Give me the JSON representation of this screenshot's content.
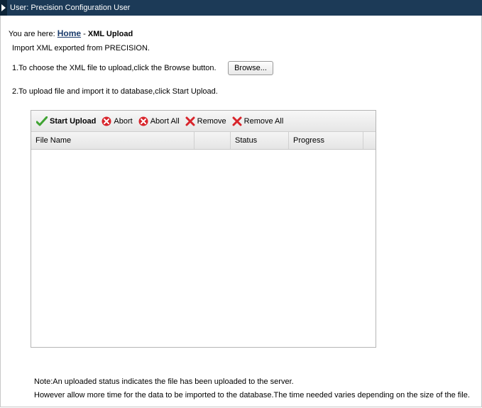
{
  "header": {
    "title": "User: Precision Configuration User"
  },
  "breadcrumb": {
    "prefix": "You are here:",
    "home": "Home",
    "separator": "-",
    "current": "XML Upload"
  },
  "instructions": {
    "intro": "Import XML exported from PRECISION.",
    "step1": "1.To choose the XML file to upload,click the Browse button.",
    "browse_label": "Browse...",
    "step2": "2.To upload file and import it to database,click Start Upload."
  },
  "toolbar": {
    "start_upload": "Start Upload",
    "abort": "Abort",
    "abort_all": "Abort All",
    "remove": "Remove",
    "remove_all": "Remove All"
  },
  "table": {
    "columns": [
      "File Name",
      "",
      "Status",
      "Progress"
    ],
    "rows": []
  },
  "notes": {
    "line1": "Note:An uploaded status indicates the file has been uploaded to the server.",
    "line2": "However allow more time for the data to be imported to the database.The time needed varies depending on the size of the file."
  },
  "colors": {
    "header_bg": "#1c3a57",
    "link": "#1a3b6c",
    "check": "#3fa332",
    "abort": "#d8232a",
    "remove": "#d8232a"
  },
  "icons": {
    "header": "chevron-right-icon",
    "start_upload": "checkmark-icon",
    "abort": "abort-x-circle-icon",
    "remove": "x-icon"
  }
}
